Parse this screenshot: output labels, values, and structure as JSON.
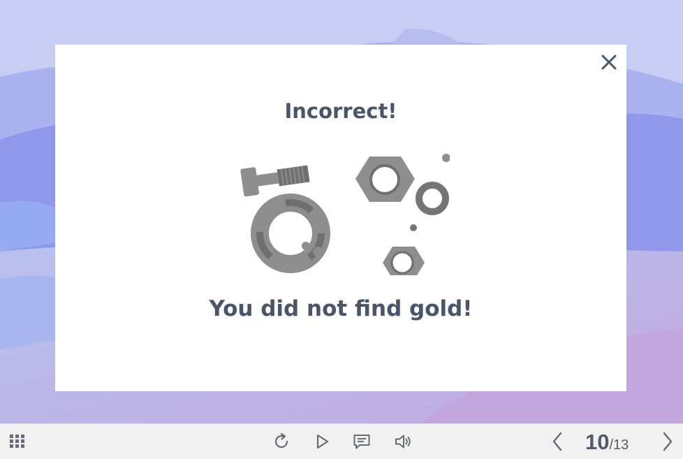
{
  "modal": {
    "title": "Incorrect!",
    "message": "You did not find gold!",
    "close_icon": "close-icon",
    "illustration": "nuts-and-bolts-illustration"
  },
  "toolbar": {
    "icons": [
      "grid-menu-icon",
      "replay-icon",
      "play-icon",
      "comment-icon",
      "volume-icon",
      "chevron-left-icon",
      "chevron-right-icon"
    ],
    "page_current": "10",
    "page_separator": "/",
    "page_total": "13"
  },
  "colors": {
    "background": "#c8cdf3",
    "wave_primary": "#8f98ea",
    "modal_bg": "#ffffff",
    "text": "#4a5568",
    "illustration_gray": "#8e8e8e",
    "toolbar_bg": "#f1f1f1",
    "toolbar_icon": "#666c77"
  }
}
